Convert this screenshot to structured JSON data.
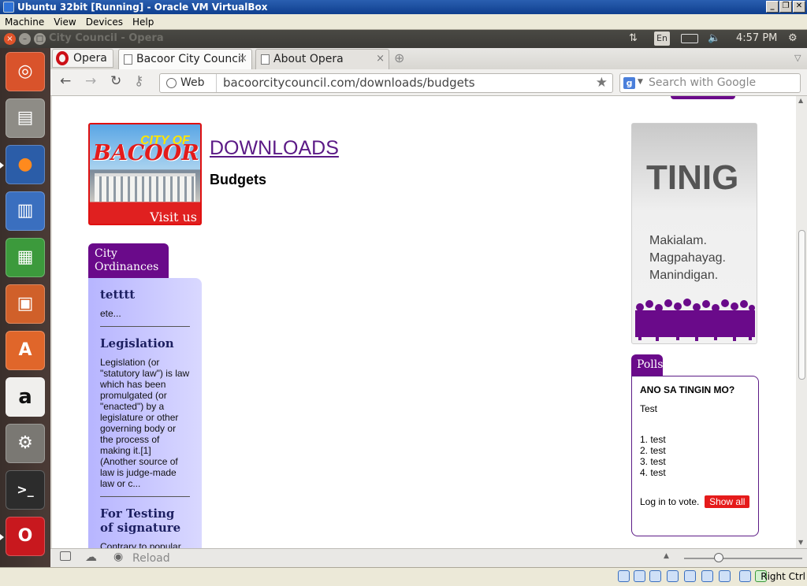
{
  "vbox": {
    "title": "Ubuntu 32bit [Running] - Oracle VM VirtualBox",
    "menu": [
      "Machine",
      "View",
      "Devices",
      "Help"
    ],
    "host_key": "Right Ctrl"
  },
  "panel": {
    "app_title": "City Council - Opera",
    "keyboard": "En",
    "time": "4:57 PM"
  },
  "launcher": [
    "ubuntu-dash",
    "files",
    "firefox",
    "writer",
    "calc",
    "impress",
    "software-center",
    "amazon",
    "system-settings",
    "terminal",
    "opera"
  ],
  "browser": {
    "menu_label": "Opera",
    "tabs": [
      {
        "title": "Bacoor City Council",
        "active": true
      },
      {
        "title": "About Opera",
        "active": false
      }
    ],
    "address_prefix": "Web",
    "url": "bacoorcitycouncil.com/downloads/budgets",
    "search_placeholder": "Search with Google",
    "status_reload": "Reload"
  },
  "page": {
    "logo": {
      "line1": "CITY OF",
      "line2": "BACOOR",
      "visit": "Visit us"
    },
    "heading": "DOWNLOADS",
    "subheading": "Budgets",
    "ordinances": {
      "tab_label": "City Ordinances",
      "items": [
        {
          "title": "tetttt",
          "excerpt": "ete..."
        },
        {
          "title": "Legislation",
          "excerpt": "Legislation (or \"statutory law\") is law which has been promulgated (or \"enacted\") by a legislature or other governing body or the process of making it.[1] (Another source of law is judge-made law or c..."
        },
        {
          "title": "For Testing of signature",
          "excerpt": "Contrary to popular"
        }
      ]
    },
    "tinig": {
      "title": "TINIG",
      "lines": [
        "Makialam.",
        "Magpahayag.",
        "Manindigan."
      ]
    },
    "polls": {
      "tab_label": "Polls",
      "question": "ANO SA TINGIN MO?",
      "text": "Test",
      "options": [
        "1. test",
        "2. test",
        "3. test",
        "4. test"
      ],
      "login": "Log in to vote.",
      "show_all": "Show all"
    }
  },
  "colors": {
    "accent_purple": "#6a0a8a",
    "opera_red": "#cc0f16",
    "ubuntu_orange": "#dd4814"
  }
}
